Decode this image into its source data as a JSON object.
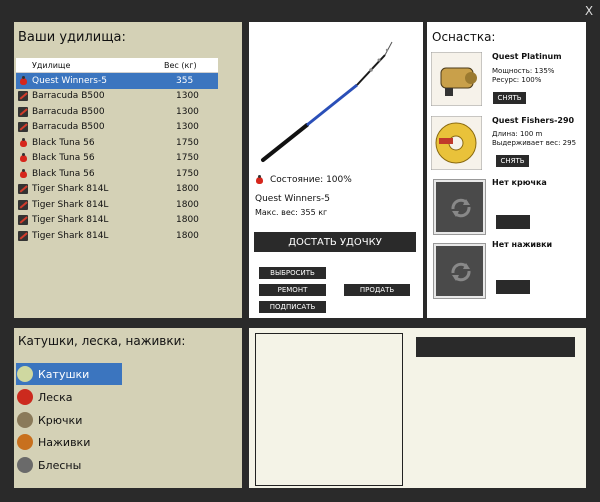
{
  "window": {
    "close_label": "X"
  },
  "rods": {
    "title": "Ваши удилища:",
    "col_name": "Удилище",
    "col_weight": "Вес (кг)",
    "items": [
      {
        "name": "Quest Winners-5",
        "weight": "355",
        "icon": "bell-icon",
        "selected": true
      },
      {
        "name": "Barracuda B500",
        "weight": "1300",
        "icon": "rod-icon"
      },
      {
        "name": "Barracuda B500",
        "weight": "1300",
        "icon": "rod-icon"
      },
      {
        "name": "Barracuda B500",
        "weight": "1300",
        "icon": "rod-icon"
      },
      {
        "name": "Black Tuna 56",
        "weight": "1750",
        "icon": "bell-icon"
      },
      {
        "name": "Black Tuna 56",
        "weight": "1750",
        "icon": "bell-icon"
      },
      {
        "name": "Black Tuna 56",
        "weight": "1750",
        "icon": "bell-icon"
      },
      {
        "name": "Tiger Shark 814L",
        "weight": "1800",
        "icon": "rod-icon"
      },
      {
        "name": "Tiger Shark 814L",
        "weight": "1800",
        "icon": "rod-icon"
      },
      {
        "name": "Tiger Shark 814L",
        "weight": "1800",
        "icon": "rod-icon"
      },
      {
        "name": "Tiger Shark 814L",
        "weight": "1800",
        "icon": "rod-icon"
      }
    ]
  },
  "detail": {
    "condition": "Состояние: 100%",
    "name": "Quest Winners-5",
    "max_weight": "Макс. вес: 355 кг",
    "get_rod": "ДОСТАТЬ УДОЧКУ",
    "btn_throw": "ВЫБРОСИТЬ",
    "btn_repair": "РЕМОНТ",
    "btn_sign": "ПОДПИСАТЬ",
    "btn_sell": "ПРОДАТЬ"
  },
  "tackle": {
    "title": "Оснастка:",
    "reel": {
      "name": "Quest Platinum",
      "line1": "Мощность: 135%",
      "line2": "Ресурс: 100%",
      "btn": "СНЯТЬ"
    },
    "line": {
      "name": "Quest Fishers-290",
      "line1": "Длина: 100 m",
      "line2": "Выдерживает вес: 295",
      "btn": "СНЯТЬ"
    },
    "hook": {
      "name": "Нет крючка"
    },
    "bait": {
      "name": "Нет наживки"
    }
  },
  "categories": {
    "title": "Катушки, леска, наживки:",
    "items": [
      {
        "label": "Катушки",
        "icon": "reel-icon",
        "color": "#cfd8a0",
        "selected": true
      },
      {
        "label": "Леска",
        "icon": "line-icon",
        "color": "#cc2a1e"
      },
      {
        "label": "Крючки",
        "icon": "hook-icon",
        "color": "#8a7a5a"
      },
      {
        "label": "Наживки",
        "icon": "bait-icon",
        "color": "#c8701e"
      },
      {
        "label": "Блесны",
        "icon": "lure-icon",
        "color": "#6a6a6a"
      }
    ]
  },
  "colors": {
    "selection": "#3b75bf",
    "panel": "#d4d1b6",
    "cream": "#f4f3e7",
    "dark": "#2a2a2a"
  }
}
